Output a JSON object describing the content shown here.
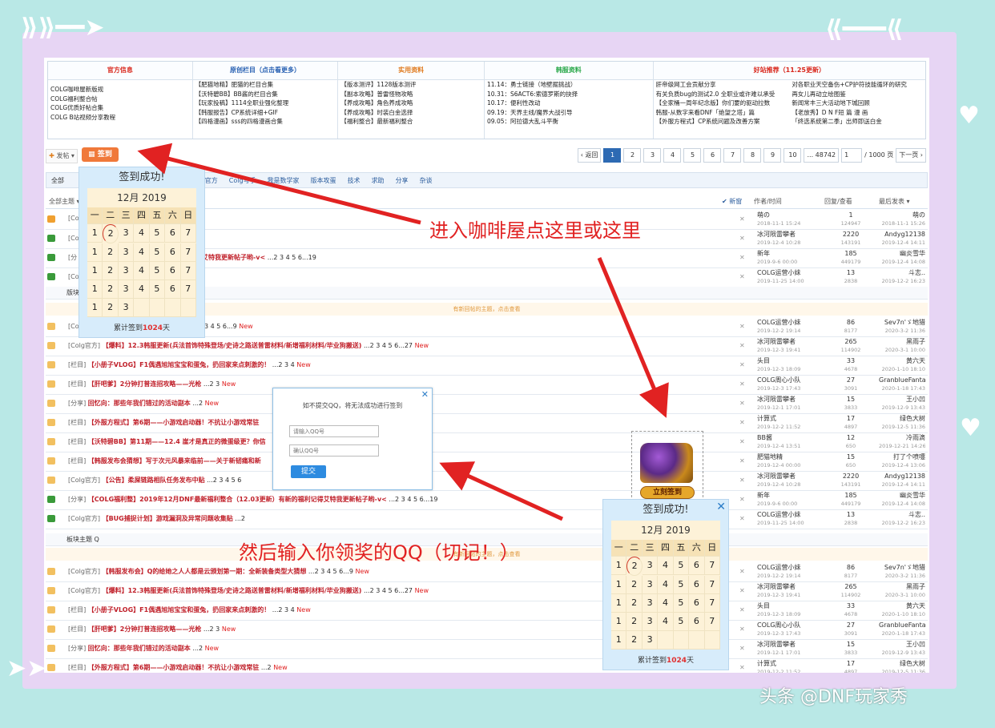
{
  "links": {
    "columns": [
      {
        "header": "官方信息",
        "color": "#d9281d",
        "items": [
          "COLG咖啡屋新版规",
          "COLG福利整合帖",
          "COLG优质好帖合集",
          "COLG B站视频分享教程"
        ]
      },
      {
        "header": "原创栏目（点击看更多）",
        "color": "#2a62b3",
        "items": [
          "【肥猫地精】肥猫的栏目合集",
          "【沃特碧BB】BB酱的栏目合集",
          "【玩家投稿】1114全职业强化整理",
          "【韩服报告】CP系统详细+GIF",
          "【四格漫画】sss的四格漫画合集"
        ]
      },
      {
        "header": "实用资料",
        "color": "#e07b20",
        "items": [
          "【版本测评】1128版本测评",
          "【副本攻略】普雷怪物攻略",
          "【养成攻略】角色养成攻略",
          "【养成攻略】时装白金选择",
          "【福利整合】最新福利整合"
        ]
      },
      {
        "header": "韩服资料",
        "color": "#2aa84a",
        "items": [
          "11.14：勇士链接（地壁掘挑战）",
          "10.31：S6ACT6:索德罗斯的抉择",
          "10.17：便利性改动",
          "09.19：天界主线/魔界大战引导",
          "09.05：阿拉德大乱斗平衡"
        ]
      },
      {
        "header": "好站推荐（11.25更新）",
        "color": "#d9281d",
        "items": [
          "肝帝级网工会贡献分享",
          "有关负质bug的测试2.0 全职业或许难以承受",
          "【全家桶一周年纪念版】你们要的驱动拉数",
          "韩服-从数字来看DNF「绝望之塔」篇",
          "【外服方程式】CP系统问题及改善方案"
        ],
        "items2": [
          "对各职业天空备伤+CP护符技能循环的研究",
          "再女儿再动立绘图鉴",
          "新闻常丰三大活动地下城回顾",
          "【老放秀】D N F短 篇 漫 画",
          "「终选系统第二季」出师即送白金"
        ]
      }
    ]
  },
  "toolbar": {
    "post": "发帖",
    "sign": "签到"
  },
  "pager": {
    "prev": "‹ 返回",
    "pages": [
      "1",
      "2",
      "3",
      "4",
      "5",
      "6",
      "7",
      "8",
      "9",
      "10",
      "... 48742"
    ],
    "input_value": "1",
    "total": "/ 1000 页",
    "next": "下一页 ›"
  },
  "categories": [
    "全部",
    "Colg官方",
    "Colg写手",
    "我是数学家",
    "版本攻蛋",
    "技术",
    "求助",
    "分享",
    "杂谈"
  ],
  "listhead": {
    "new": "✔ 新窗",
    "author": "作者/时间",
    "reply": "回复/查看",
    "last": "最后发表 ▾",
    "all": "全部主题 ▾"
  },
  "threads_top": [
    {
      "color": "#f0a030",
      "title": "[Co",
      "hot": "",
      "extra": "",
      "author": "萌の",
      "date": "2018-11-1 15:24",
      "replies": "1",
      "views": "124947",
      "last": "萌の",
      "ldate": "2018-11-1 15:26"
    },
    {
      "color": "#3a9a3a",
      "title": "[Co",
      "hot": "中贴",
      "extra": " ...2 3 4 5 6...223",
      "author": "冰河陨雷攀者",
      "date": "2019-12-4 10:28",
      "replies": "2220",
      "views": "143191",
      "last": "Andyg12138",
      "ldate": "2019-12-4 14:11"
    },
    {
      "color": "#3a9a3a",
      "title": "[分",
      "hot": "新福利整合（12.03更新）有新的福利记得艾特我更新帖子哟-v<",
      "extra": " ...2 3 4 5 6...19",
      "author": "新年",
      "date": "2019-9-6 00:00",
      "replies": "185",
      "views": "449179",
      "last": "幽炎雪华",
      "ldate": "2019-12-4 14:08"
    },
    {
      "color": "#3a9a3a",
      "title": "[Co",
      "hot": "问题收集贴",
      "extra": " ...2",
      "author": "COLG运营小妹",
      "date": "2019-11-25 14:00",
      "replies": "13",
      "views": "2838",
      "last": "斗志..",
      "ldate": "2019-12-2 16:23"
    }
  ],
  "section1": "版块主题",
  "notice": "有新回帖的主题，点击查看",
  "threads_mid": [
    {
      "tag": "[Co",
      "hot": "是云颁划第一期：全新装备类型大猜想",
      "extra": " ...2 3 4 5 6...9",
      "new": "New",
      "author": "COLG运营小妹",
      "date": "2019-12-2 19:14",
      "replies": "86",
      "views": "8177",
      "last": "Sev7n'ゞ地猎",
      "ldate": "2020-3-2 11:36"
    },
    {
      "tag": "[Colg官方]",
      "hot": "【爆料】12.3韩服更新(兵法首饰特殊登场/史诗之路送普雷材料/新增福利材料/毕业狗搬送)",
      "extra": " ...2 3 4 5 6...27",
      "new": "New",
      "author": "冰河陨雷攀者",
      "date": "2019-12-3 19:41",
      "replies": "265",
      "views": "114902",
      "last": "黑雨子",
      "ldate": "2020-3-1 10:00"
    },
    {
      "tag": "[栏目]",
      "hot": "【小册子VLOG】F1偶遇旭旭宝宝和蛋兔，扔回家来点刺激的！",
      "extra": " ...2 3 4",
      "new": "New",
      "author": "头目",
      "date": "2019-12-3 18:09",
      "replies": "33",
      "views": "4678",
      "last": "黄六天",
      "ldate": "2020-1-10 18:10"
    },
    {
      "tag": "[栏目]",
      "hot": "【肝吧爹】2分钟打普连招攻略——光枪",
      "extra": " ...2 3",
      "new": "New",
      "author": "COLG周心小队",
      "date": "2019-12-3 17:43",
      "replies": "27",
      "views": "3091",
      "last": "GranblueFantas",
      "ldate": "2020-1-18 17:43"
    },
    {
      "tag": "[分享]",
      "hot": "回忆向：那些年我们错过的活动副本",
      "extra": " ...2",
      "new": "New",
      "author": "冰河陨雷攀者",
      "date": "2019-12-1 17:01",
      "replies": "15",
      "views": "3833",
      "last": "王小凹",
      "ldate": "2019-12-9 13:43"
    },
    {
      "tag": "[栏目]",
      "hot": "【外服方程式】第6期——小游戏启动器！不抗让小游戏常驻",
      "extra": "",
      "new": "",
      "author": "计算式",
      "date": "2019-12-2 11:52",
      "replies": "17",
      "views": "4897",
      "last": "绿色大树",
      "ldate": "2019-12-5 11:36"
    },
    {
      "tag": "[栏目]",
      "hot": "【沃特碧BB】第11期——12.4 崖才是真正的微蛋级更？你信",
      "extra": "",
      "new": "",
      "author": "BB酱",
      "date": "2019-12-4 13:51",
      "replies": "12",
      "views": "650",
      "last": "冷雨滴",
      "ldate": "2019-12-21 14:26"
    },
    {
      "tag": "[栏目]",
      "hot": "【韩服发布会猜想】写于次元风暴来临前——关于新韧痛和新",
      "extra": "",
      "new": "",
      "author": "肥猫地精",
      "date": "2019-12-4 00:00",
      "replies": "15",
      "views": "650",
      "last": "打了个喷嚏",
      "ldate": "2019-12-4 13:06"
    },
    {
      "tag": "[Colg官方]",
      "hot": "【公告】柔屎链路相队任务发布中贴",
      "extra": " ...2 3 4 5 6",
      "new": "",
      "author": "冰河陨雷攀者",
      "date": "2019-12-4 10:28",
      "replies": "2220",
      "views": "143191",
      "last": "Andyg12138",
      "ldate": "2019-12-4 14:11"
    },
    {
      "tag": "[分享]",
      "hot": "【COLG福利整】2019年12月DNF最新福利整合（12.03更新）有新的福利记得艾特我更新帖子哟-v<",
      "extra": " ...2 3 4 5 6...19",
      "new": "",
      "author": "新年",
      "date": "2019-9-6 00:00",
      "replies": "185",
      "views": "449179",
      "last": "幽炎雪华",
      "ldate": "2019-12-4 14:08"
    },
    {
      "tag": "[Colg官方]",
      "hot": "【BUG捕捉计划】游戏漏洞及异常问题收集贴",
      "extra": " ...2",
      "new": "",
      "author": "COLG运营小妹",
      "date": "2019-11-25 14:00",
      "replies": "13",
      "views": "2838",
      "last": "斗志..",
      "ldate": "2019-12-2 16:23"
    }
  ],
  "section2": "板块主题 Q",
  "threads_bottom": [
    {
      "tag": "[Colg官方]",
      "hot": "【韩服发布会】Q的给她之人人都是云颁划第一期：全新装备类型大猜想",
      "extra": " ...2 3 4 5 6...9",
      "new": "New",
      "author": "COLG运营小妹",
      "date": "2019-12-2 19:14",
      "replies": "86",
      "views": "8177",
      "last": "Sev7n'ゞ地猎",
      "ldate": "2020-3-2 11:36"
    },
    {
      "tag": "[Colg官方]",
      "hot": "【爆料】12.3韩服更新(兵法首饰特殊登场/史诗之路送普雷材料/新增福利材料/毕业狗搬送)",
      "extra": " ...2 3 4 5 6...27",
      "new": "New",
      "author": "冰河陨雷攀者",
      "date": "2019-12-3 19:41",
      "replies": "265",
      "views": "114902",
      "last": "黑雨子",
      "ldate": "2020-3-1 10:00"
    },
    {
      "tag": "[栏目]",
      "hot": "【小册子VLOG】F1偶遇旭旭宝宝和蛋兔，扔回家来点刺激的！",
      "extra": " ...2 3 4",
      "new": "New",
      "author": "头目",
      "date": "2019-12-3 18:09",
      "replies": "33",
      "views": "4678",
      "last": "黄六天",
      "ldate": "2020-1-10 18:10"
    },
    {
      "tag": "[栏目]",
      "hot": "【肝吧爹】2分钟打普连招攻略——光枪",
      "extra": " ...2 3",
      "new": "New",
      "author": "COLG周心小队",
      "date": "2019-12-3 17:43",
      "replies": "27",
      "views": "3091",
      "last": "GranblueFantas",
      "ldate": "2020-1-18 17:43"
    },
    {
      "tag": "[分享]",
      "hot": "回忆向：那些年我们错过的活动副本",
      "extra": " ...2",
      "new": "New",
      "author": "冰河陨雷攀者",
      "date": "2019-12-1 17:01",
      "replies": "15",
      "views": "3833",
      "last": "王小凹",
      "ldate": "2019-12-9 13:43"
    },
    {
      "tag": "[栏目]",
      "hot": "【外服方程式】第6期——小游戏启动器！不抗让小游戏常驻",
      "extra": " ...2",
      "new": "New",
      "author": "计算式",
      "date": "2019-12-2 11:52",
      "replies": "17",
      "views": "4897",
      "last": "绿色大树",
      "ldate": "2019-12-5 11:36"
    }
  ],
  "calendar": {
    "title": "签到成功!",
    "month": "12月",
    "year": "2019",
    "weekdays": [
      "一",
      "二",
      "三",
      "四",
      "五",
      "六",
      "日"
    ],
    "rows": [
      [
        "1",
        "2",
        "3",
        "4",
        "5",
        "6",
        "7"
      ],
      [
        "1",
        "2",
        "3",
        "4",
        "5",
        "6",
        "7"
      ],
      [
        "1",
        "2",
        "3",
        "4",
        "5",
        "6",
        "7"
      ],
      [
        "1",
        "2",
        "3",
        "4",
        "5",
        "6",
        "7"
      ],
      [
        "1",
        "2",
        "3",
        "",
        "",
        "",
        ""
      ]
    ],
    "footer_prefix": "累计签到",
    "days": "1024",
    "footer_suffix": "天"
  },
  "qq_dialog": {
    "message": "如不提交QQ，将无法成功进行签到",
    "placeholder1": "请输入QQ号",
    "placeholder2": "确认QQ号",
    "submit": "提交"
  },
  "chest": {
    "label": "立刻签到"
  },
  "annotations": {
    "top": "进入咖啡屋点这里或这里",
    "bottom": "然后输入你领奖的QQ（切记！）",
    "color": "#e12222"
  },
  "watermark": "头条 @DNF玩家秀"
}
